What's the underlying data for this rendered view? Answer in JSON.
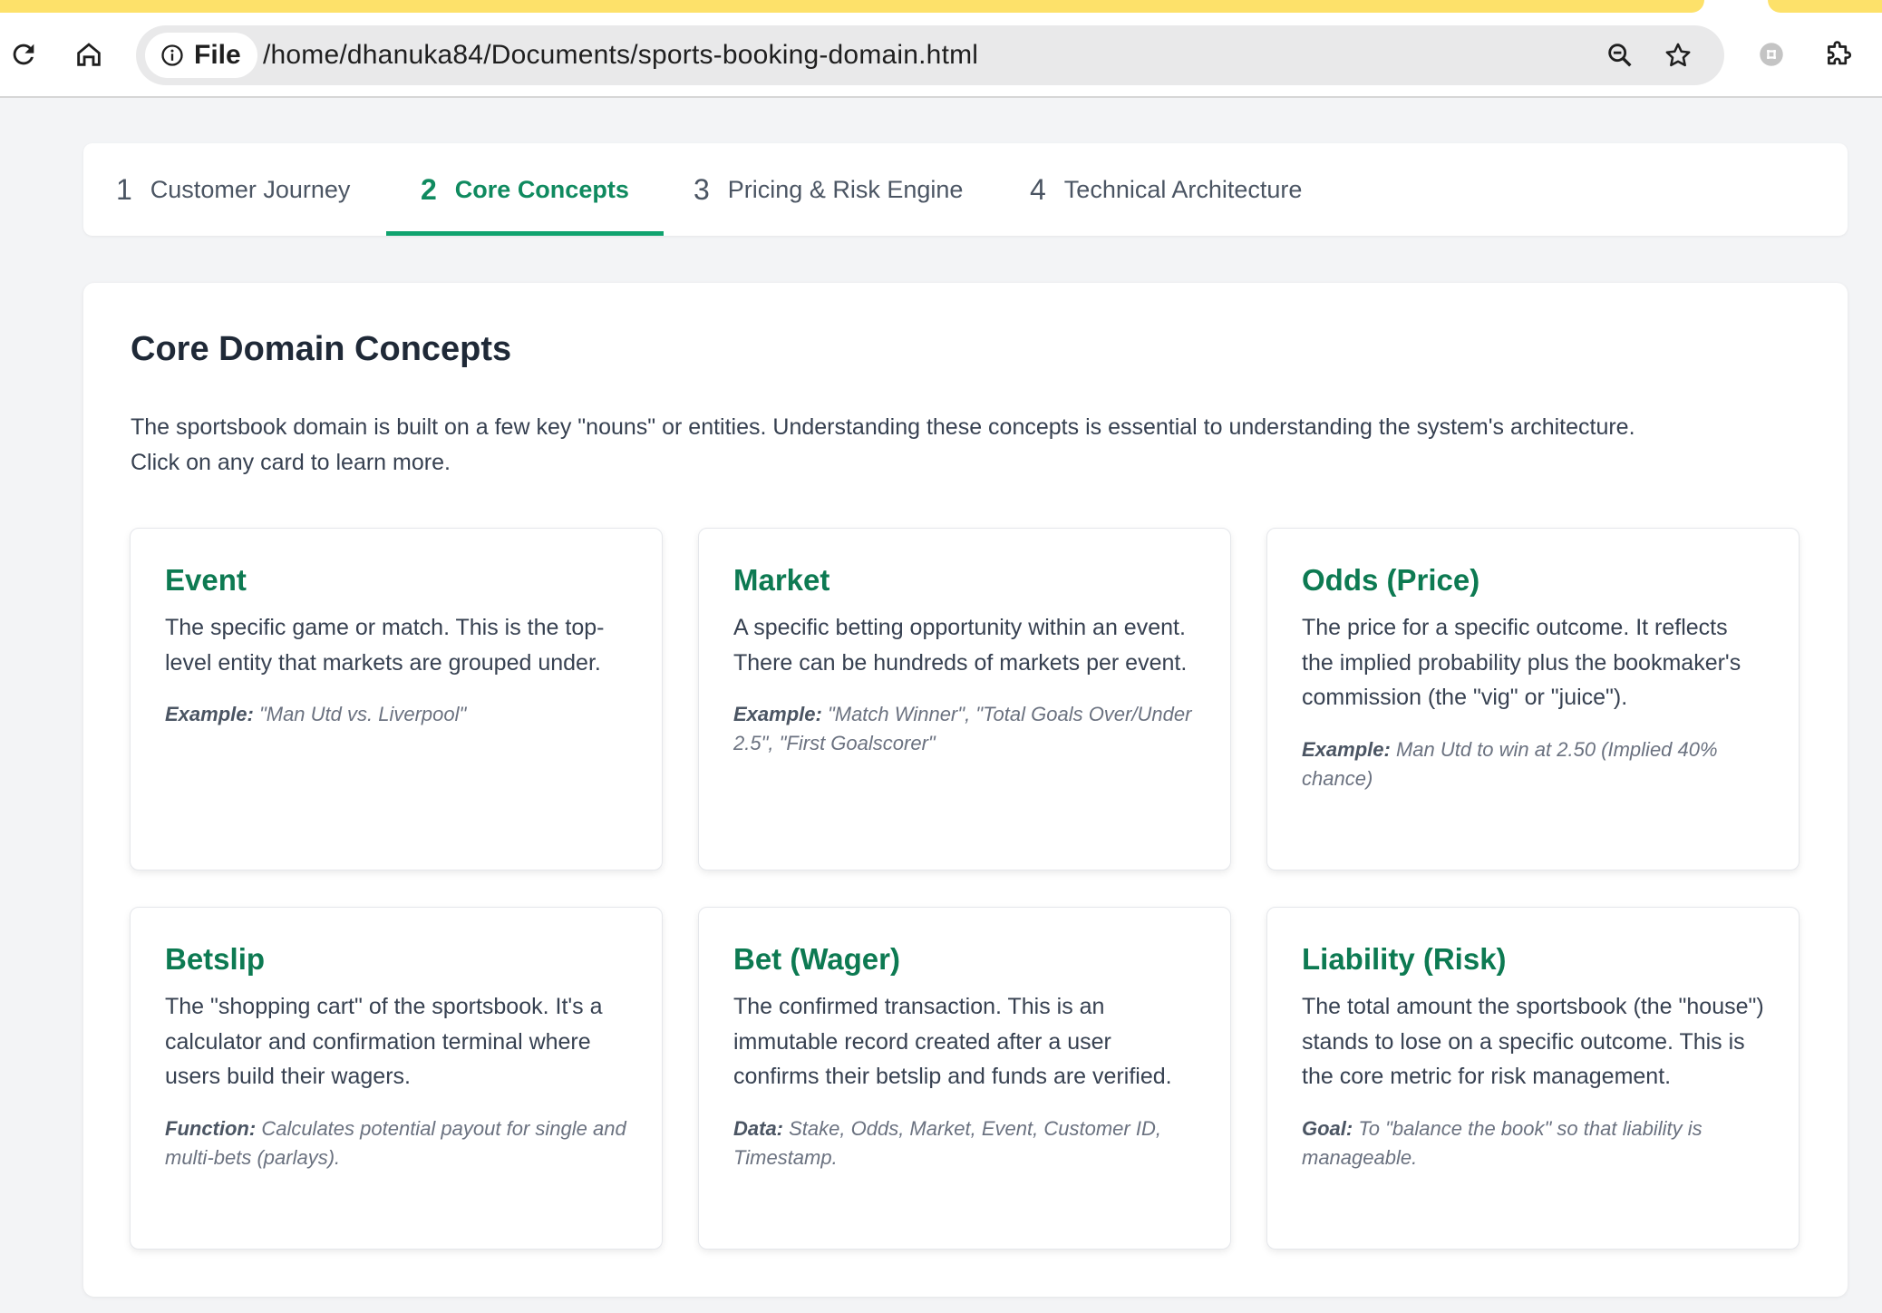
{
  "browser": {
    "site_chip": "File",
    "url": "/home/dhanuka84/Documents/sports-booking-domain.html",
    "icons": [
      "reload-icon",
      "home-icon",
      "info-icon",
      "zoom-icon",
      "bookmark-star-icon",
      "extension-puzzle-icon",
      "profile-icon"
    ],
    "accent_tabstrip": "#fde16a"
  },
  "tabs": [
    {
      "num": "1",
      "label": "Customer Journey"
    },
    {
      "num": "2",
      "label": "Core Concepts",
      "active": true
    },
    {
      "num": "3",
      "label": "Pricing & Risk Engine"
    },
    {
      "num": "4",
      "label": "Technical Architecture"
    }
  ],
  "main": {
    "heading": "Core Domain Concepts",
    "intro_line1": "The sportsbook domain is built on a few key \"nouns\" or entities. Understanding these concepts is essential to understanding the system's architecture.",
    "intro_line2": "Click on any card to learn more.",
    "cards": [
      {
        "title": "Event",
        "desc": "The specific game or match. This is the top-level entity that markets are grouped under.",
        "note_label": "Example:",
        "note_text": " \"Man Utd vs. Liverpool\""
      },
      {
        "title": "Market",
        "desc": "A specific betting opportunity within an event. There can be hundreds of markets per event.",
        "note_label": "Example:",
        "note_text": " \"Match Winner\", \"Total Goals Over/Under 2.5\", \"First Goalscorer\""
      },
      {
        "title": "Odds (Price)",
        "desc": "The price for a specific outcome. It reflects the implied probability plus the bookmaker's commission (the \"vig\" or \"juice\").",
        "note_label": "Example:",
        "note_text": " Man Utd to win at 2.50 (Implied 40% chance)"
      },
      {
        "title": "Betslip",
        "desc": "The \"shopping cart\" of the sportsbook. It's a calculator and confirmation terminal where users build their wagers.",
        "note_label": "Function:",
        "note_text": " Calculates potential payout for single and multi-bets (parlays)."
      },
      {
        "title": "Bet (Wager)",
        "desc": "The confirmed transaction. This is an immutable record created after a user confirms their betslip and funds are verified.",
        "note_label": "Data:",
        "note_text": " Stake, Odds, Market, Event, Customer ID, Timestamp."
      },
      {
        "title": "Liability (Risk)",
        "desc": "The total amount the sportsbook (the \"house\") stands to lose on a specific outcome. This is the core metric for risk management.",
        "note_label": "Goal:",
        "note_text": " To \"balance the book\" so that liability is manageable."
      }
    ]
  },
  "colors": {
    "accent_green": "#10a36f",
    "title_green": "#0d7a52",
    "page_bg": "#f3f4f6"
  }
}
